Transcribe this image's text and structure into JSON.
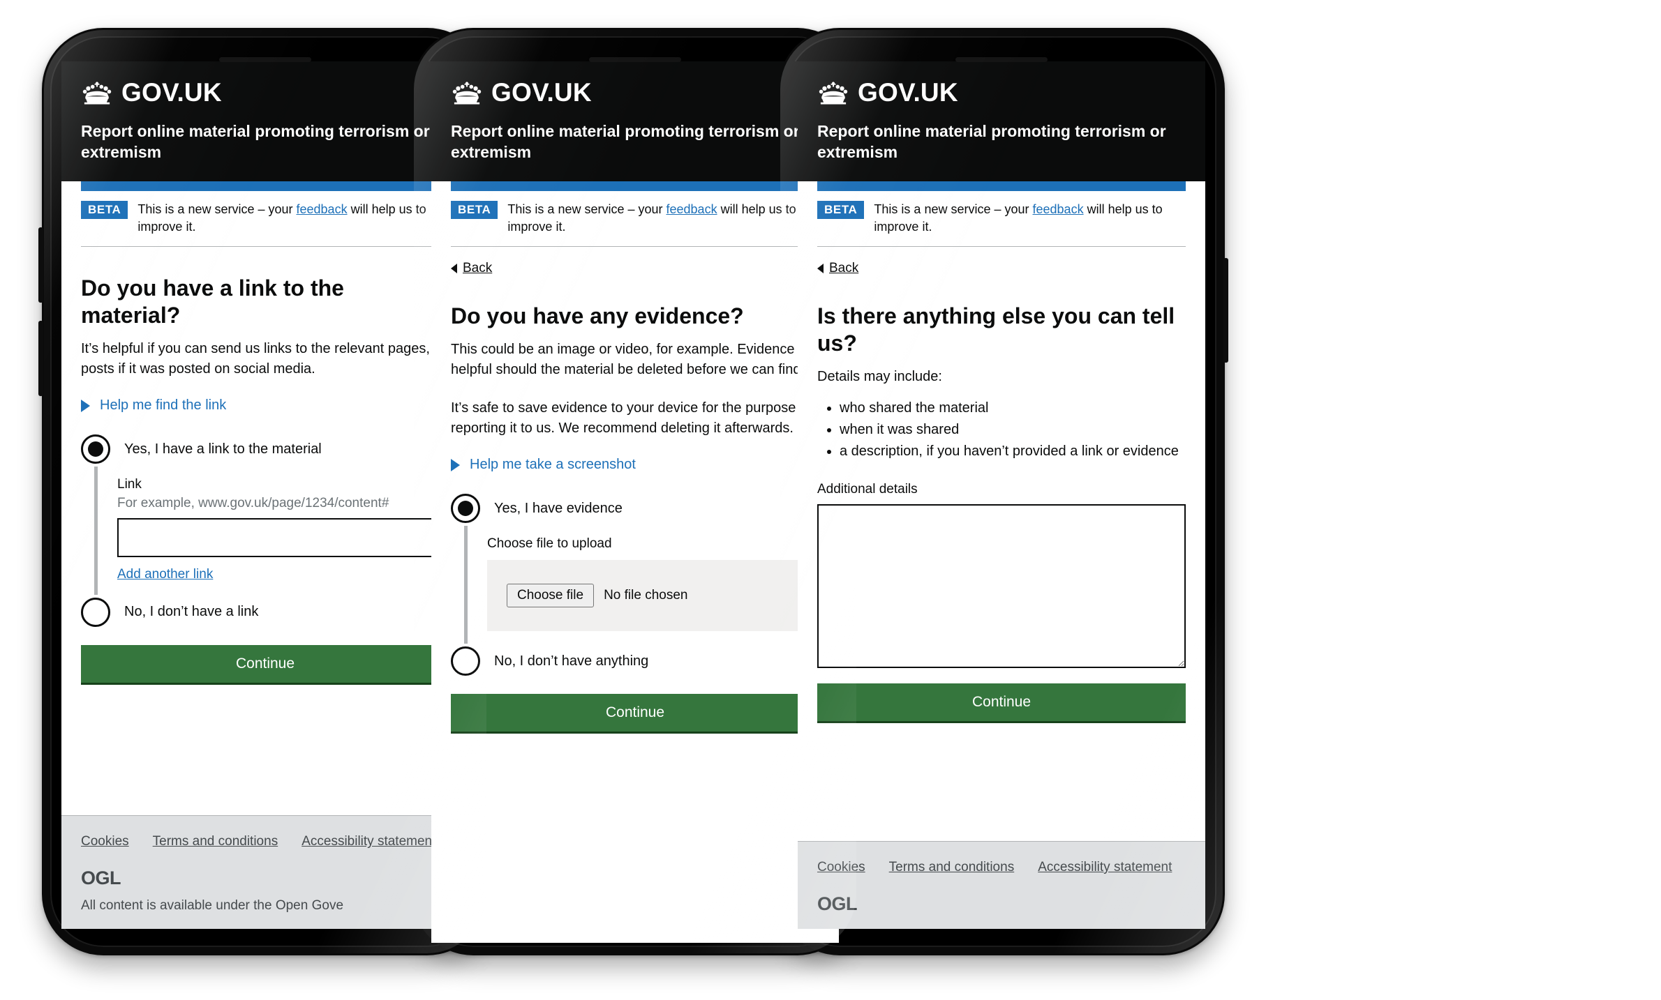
{
  "brand": {
    "wordmark": "GOV.UK",
    "crown_icon": "crown-icon",
    "service_name": "Report online material promoting terrorism or extremism"
  },
  "phase_banner": {
    "tag": "BETA",
    "text_before": "This is a new service – your ",
    "feedback_link": "feedback",
    "text_after": " will help us to improve it."
  },
  "back_link": {
    "label": "Back",
    "icon": "caret-left-icon"
  },
  "footer": {
    "links": [
      "Cookies",
      "Terms and conditions",
      "Accessibility statement"
    ],
    "ogl_mark": "OGL",
    "ogl_text": "All content is available under the Open Gove"
  },
  "common": {
    "continue_label": "Continue",
    "green": "#35763d",
    "blue": "#1d70b8",
    "black": "#0b0c0c"
  },
  "screens": [
    {
      "id": "link-question",
      "heading": "Do you have a link to the material?",
      "paragraphs": [
        "It’s helpful if you can send us links to the relevant pages, or posts if it was posted on social media."
      ],
      "details_toggle": "Help me find the link",
      "radios": [
        {
          "label": "Yes, I have a link to the material",
          "checked": true
        },
        {
          "label": "No, I don’t have a link",
          "checked": false
        }
      ],
      "conditional": {
        "field_label": "Link",
        "field_hint": "For example, www.gov.uk/page/1234/content#",
        "field_value": "",
        "add_another": "Add another link"
      },
      "show_back": false,
      "show_footer": true
    },
    {
      "id": "evidence-question",
      "heading": "Do you have any evidence?",
      "paragraphs": [
        "This could be an image or video, for example. Evidence is helpful should the material be deleted before we can find it.",
        "It’s safe to save evidence to your device for the purpose of reporting it to us. We recommend deleting it afterwards."
      ],
      "details_toggle": "Help me take a screenshot",
      "radios": [
        {
          "label": "Yes, I have evidence",
          "checked": true
        },
        {
          "label": "No, I don’t have anything",
          "checked": false
        }
      ],
      "upload": {
        "field_label": "Choose file to upload",
        "button_label": "Choose file",
        "status": "No file chosen"
      },
      "show_back": true,
      "show_footer": false
    },
    {
      "id": "additional-details-question",
      "heading": "Is there anything else you can tell us?",
      "paragraphs": [
        "Details may include:"
      ],
      "bullets": [
        "who shared the material",
        "when it was shared",
        "a description, if you haven’t provided a link or evidence"
      ],
      "textarea": {
        "field_label": "Additional details",
        "value": ""
      },
      "show_back": true,
      "show_footer": true
    }
  ]
}
